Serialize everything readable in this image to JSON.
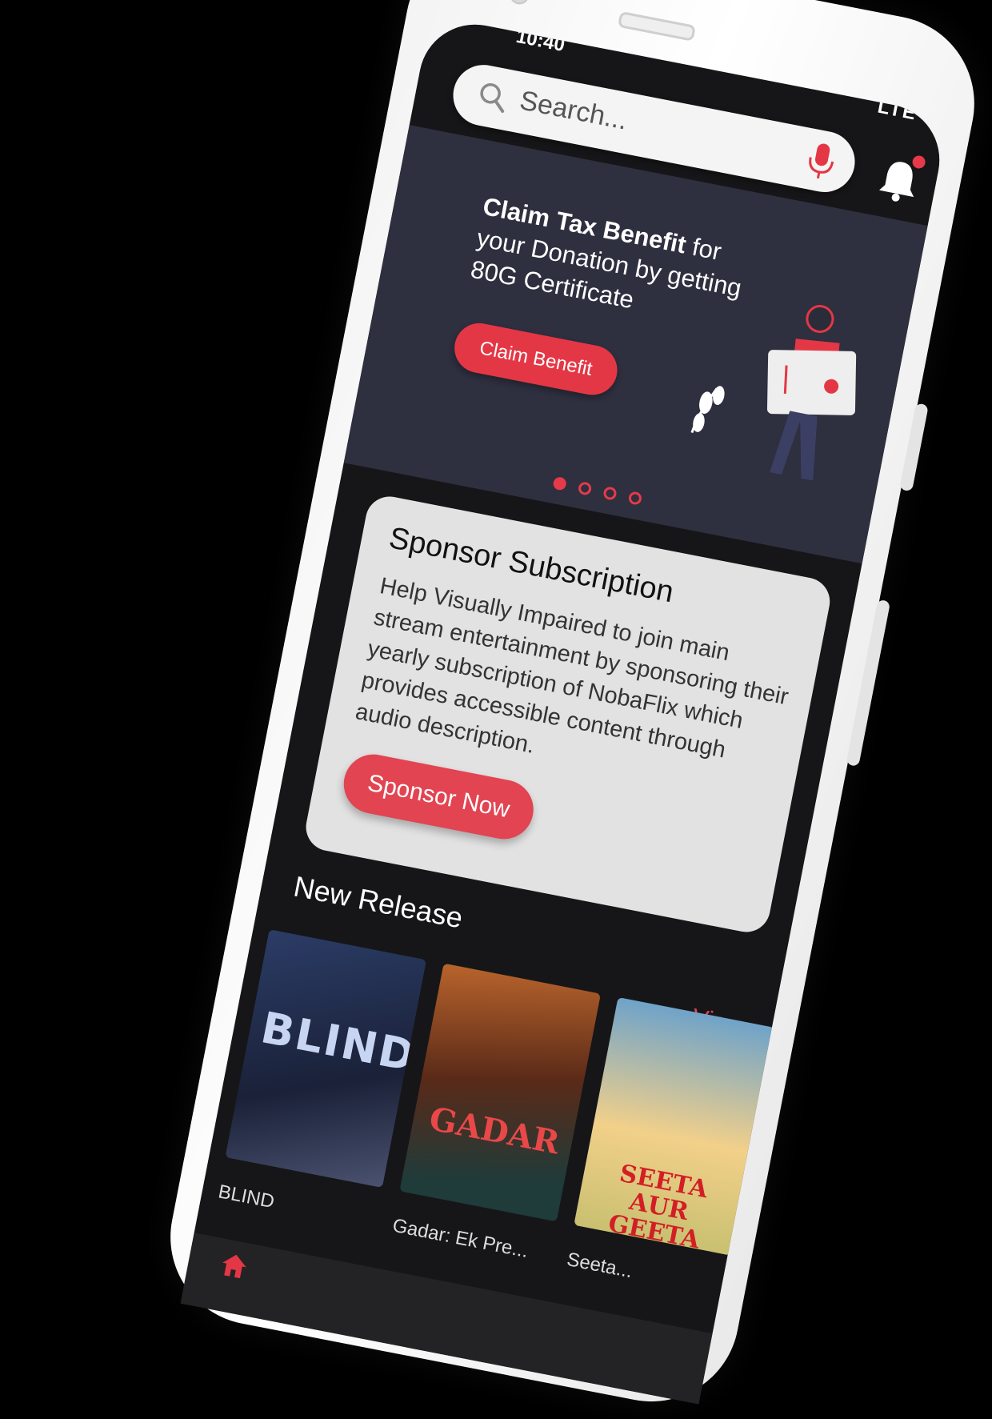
{
  "statusbar": {
    "time": "10:40",
    "right_icons": "LTE"
  },
  "search": {
    "placeholder": "Search...",
    "icon": "search-icon",
    "mic_icon": "mic-icon"
  },
  "notifications": {
    "icon": "bell-icon"
  },
  "banner": {
    "title_bold": "Claim Tax Benefit",
    "title_rest": " for your Donation by getting 80G Certificate",
    "button": "Claim Benefit",
    "carousel_pages": 4,
    "active_page": 1
  },
  "sponsor_card": {
    "title": "Sponsor Subscription",
    "body": "Help Visually Impaired to join main stream entertainment by sponsoring their yearly subscription of NobaFlix which provides accessible content through audio description.",
    "button": "Sponsor Now"
  },
  "new_release": {
    "title": "New Release",
    "view_all": "View All",
    "items": [
      {
        "title": "BLIND",
        "poster_text": "BLIND"
      },
      {
        "title": "Gadar: Ek Pre...",
        "poster_text": "GADAR"
      },
      {
        "title": "Seeta...",
        "poster_text": "SEETA AUR GEETA"
      },
      {
        "title": "",
        "poster_text": ""
      }
    ]
  },
  "colors": {
    "accent": "#e43745",
    "banner_bg": "#2e2f3f",
    "screen_bg": "#161618",
    "card_bg": "#e2e2e2"
  }
}
